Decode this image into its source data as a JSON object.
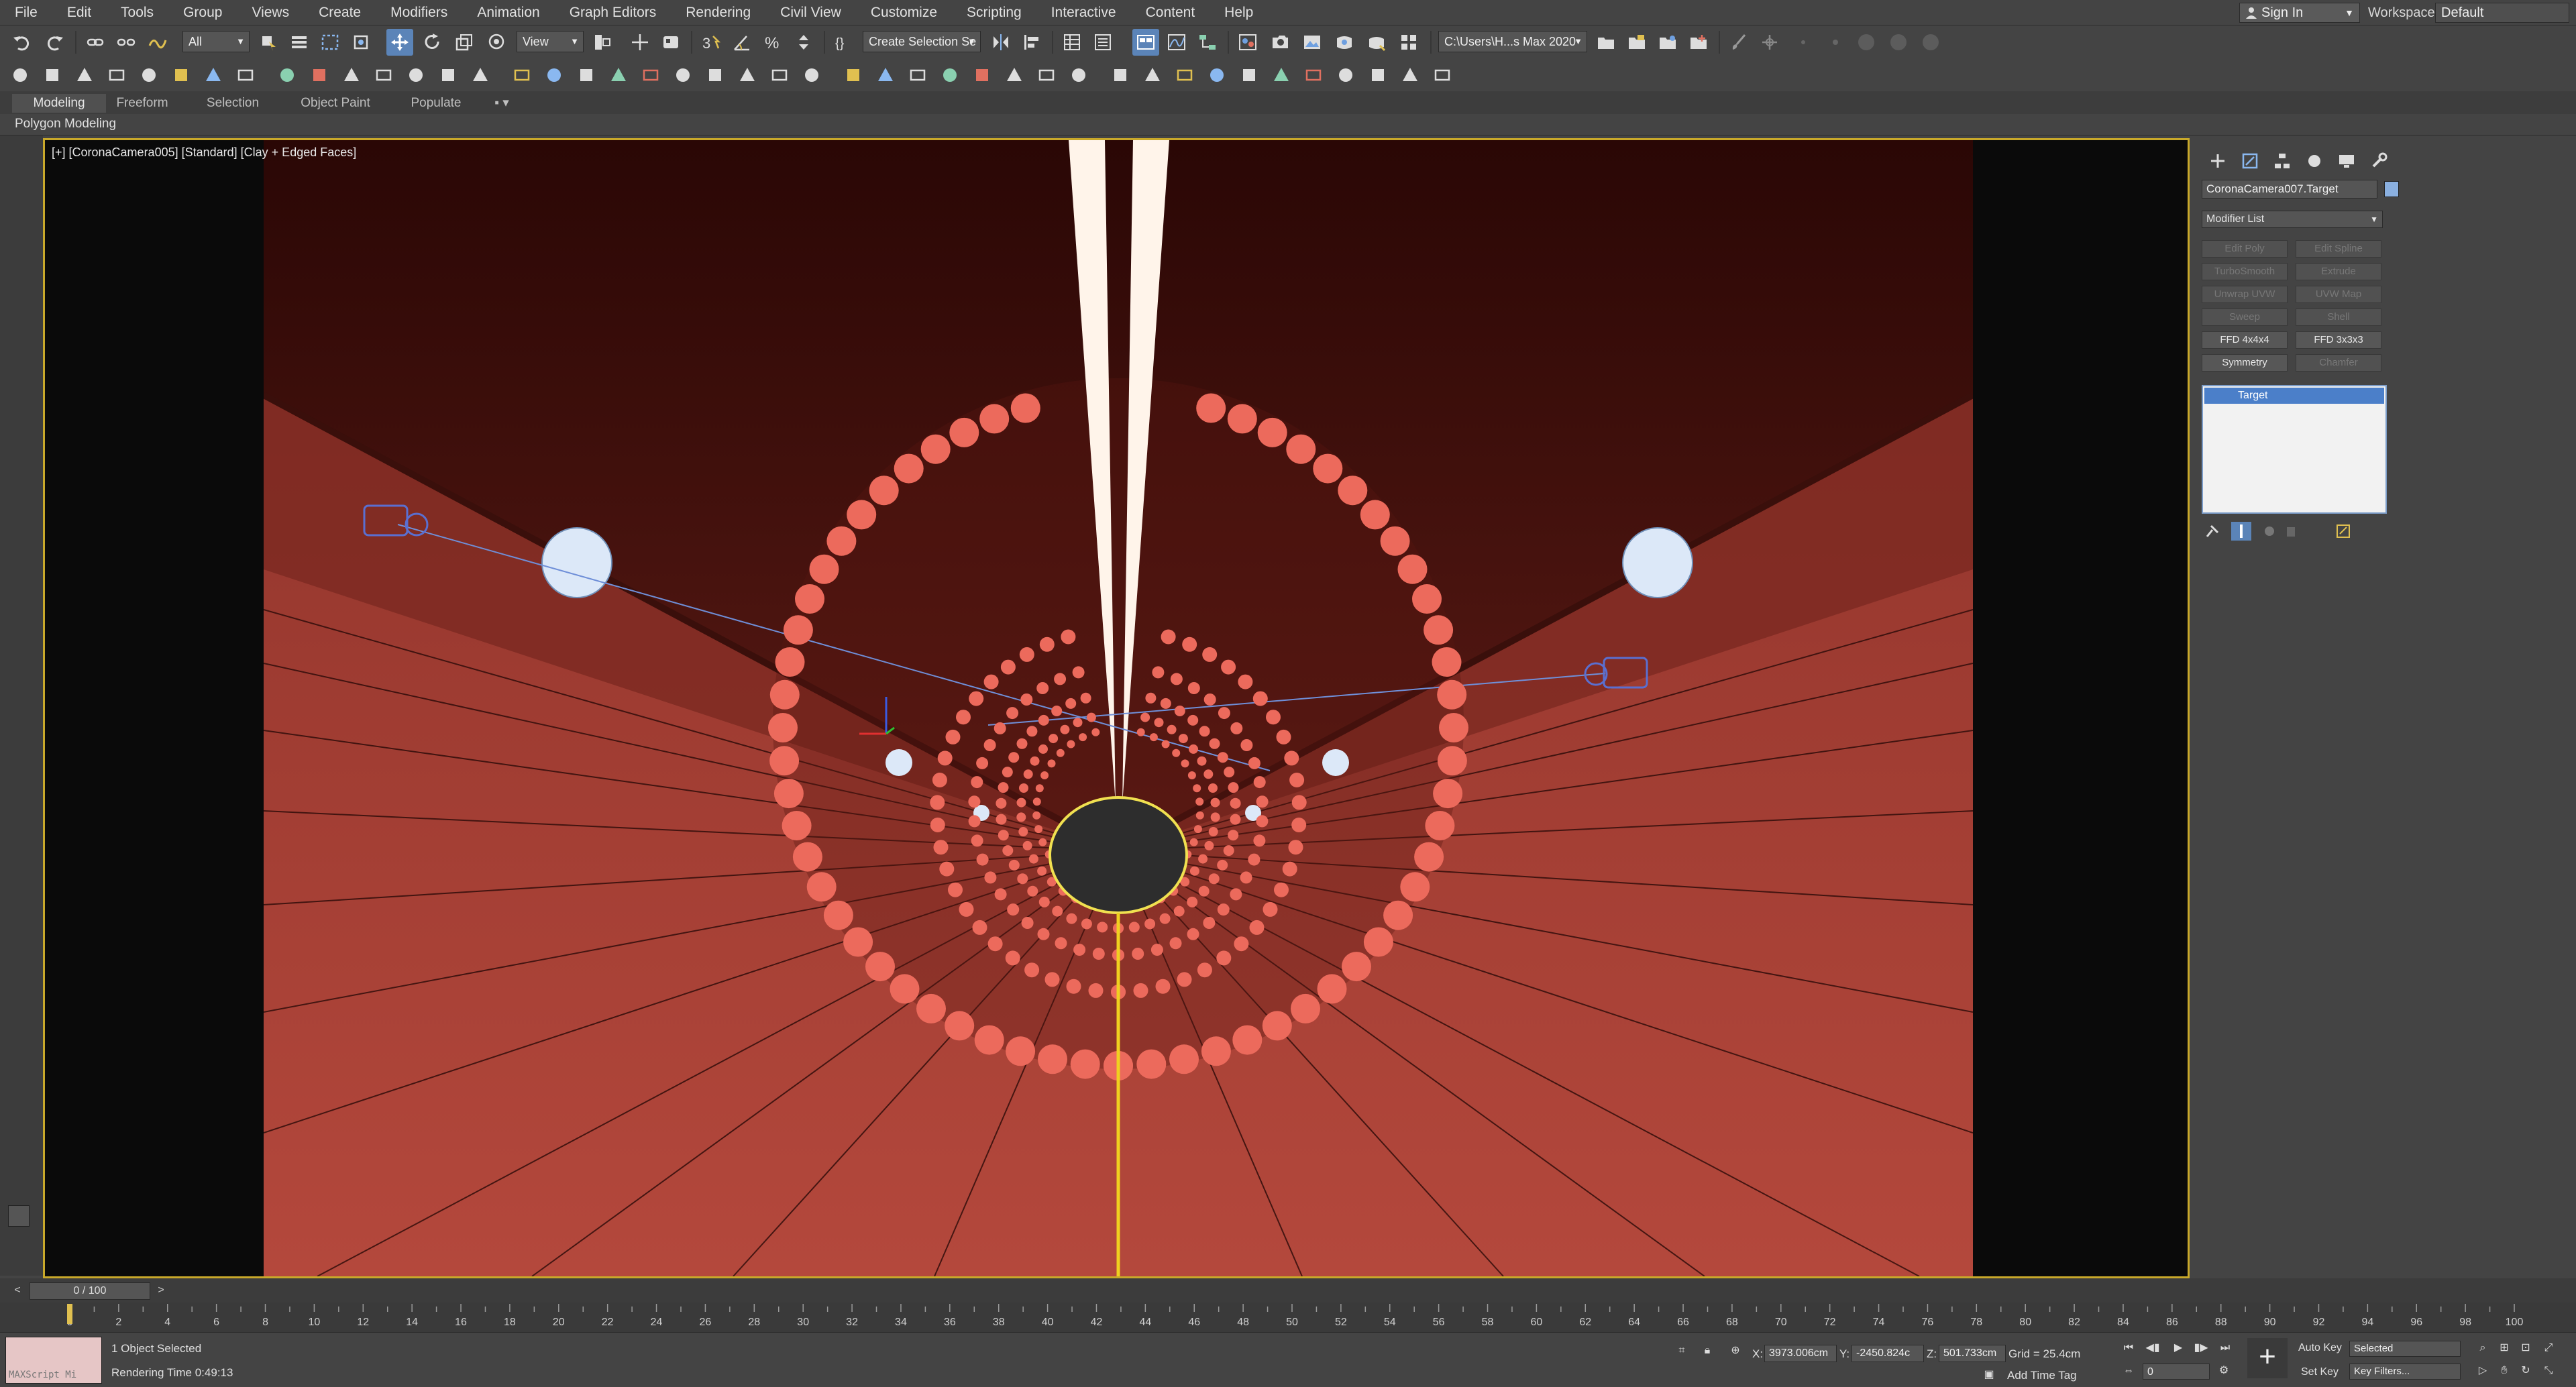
{
  "menu": [
    "File",
    "Edit",
    "Tools",
    "Group",
    "Views",
    "Create",
    "Modifiers",
    "Animation",
    "Graph Editors",
    "Rendering",
    "Civil View",
    "Customize",
    "Scripting",
    "Interactive",
    "Content",
    "Help"
  ],
  "signin": {
    "label": "Sign In"
  },
  "workspace": {
    "label": "Workspaces:",
    "value": "Default"
  },
  "toolbar": {
    "filter_value": "All",
    "ref_coord_value": "View",
    "selection_set_value": "Create Selection Se",
    "project_path": "C:\\Users\\H...s Max 2020"
  },
  "ribbon": {
    "tabs": [
      "Modeling",
      "Freeform",
      "Selection",
      "Object Paint",
      "Populate"
    ],
    "active_tab": "Modeling",
    "subpanel": "Polygon Modeling"
  },
  "viewport": {
    "label": "[+] [CoronaCamera005] [Standard] [Clay + Edged Faces]"
  },
  "command_panel": {
    "object_name": "CoronaCamera007.Target",
    "modifier_list": "Modifier List",
    "modifier_buttons": [
      {
        "label": "Edit Poly",
        "enabled": false
      },
      {
        "label": "Edit Spline",
        "enabled": false
      },
      {
        "label": "TurboSmooth",
        "enabled": false
      },
      {
        "label": "Extrude",
        "enabled": false
      },
      {
        "label": "Unwrap UVW",
        "enabled": false
      },
      {
        "label": "UVW Map",
        "enabled": false
      },
      {
        "label": "Sweep",
        "enabled": false
      },
      {
        "label": "Shell",
        "enabled": false
      },
      {
        "label": "FFD 4x4x4",
        "enabled": true
      },
      {
        "label": "FFD 3x3x3",
        "enabled": true
      },
      {
        "label": "Symmetry",
        "enabled": true
      },
      {
        "label": "Chamfer",
        "enabled": false
      }
    ],
    "stack_item": "Target"
  },
  "timeline": {
    "frame_display": "0 / 100",
    "ticks": [
      "0",
      "2",
      "4",
      "6",
      "8",
      "10",
      "12",
      "14",
      "16",
      "18",
      "20",
      "22",
      "24",
      "26",
      "28",
      "30",
      "32",
      "34",
      "36",
      "38",
      "40",
      "42",
      "44",
      "46",
      "48",
      "50",
      "52",
      "54",
      "56",
      "58",
      "60",
      "62",
      "64",
      "66",
      "68",
      "70",
      "72",
      "74",
      "76",
      "78",
      "80",
      "82",
      "84",
      "86",
      "88",
      "90",
      "92",
      "94",
      "96",
      "98",
      "100"
    ]
  },
  "status": {
    "maxscript": "MAXScript Mi",
    "selection": "1 Object Selected",
    "render_time": "Rendering Time  0:49:13",
    "x_label": "X:",
    "x_value": "3973.006cm",
    "y_label": "Y:",
    "y_value": "-2450.824c",
    "z_label": "Z:",
    "z_value": "501.733cm",
    "grid": "Grid = 25.4cm",
    "add_time_tag": "Add Time Tag",
    "auto_key": "Auto Key",
    "set_key": "Set Key",
    "key_mode_value": "Selected",
    "key_filters": "Key Filters...",
    "frame_value": "0"
  },
  "colors": {
    "viewport_border": "#c8a82a",
    "tunnel": "#a84236",
    "dots": "#ec6a5c",
    "selection_blue": "#4b7fc9"
  }
}
